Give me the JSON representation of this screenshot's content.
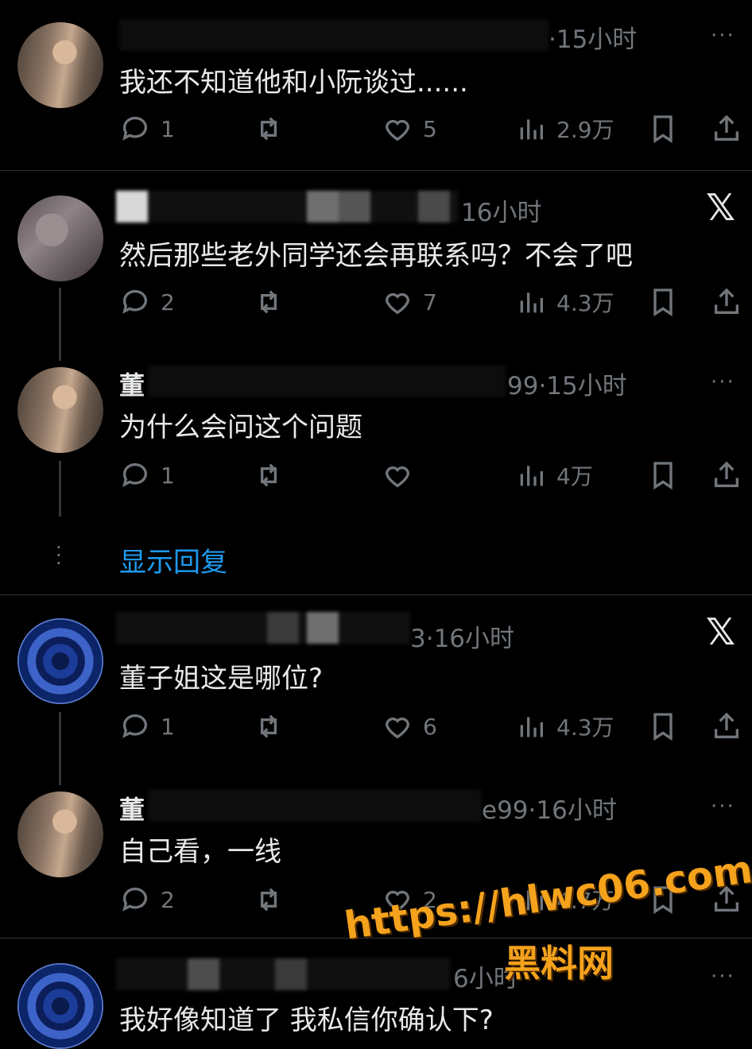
{
  "posts": [
    {
      "meta": "·15小时",
      "name_char": "",
      "text": "我还不知道他和小阮谈过......",
      "replies": "1",
      "likes": "5",
      "views": "2.9万",
      "more": "···",
      "x": false
    },
    {
      "meta": "16小时",
      "name_char": "",
      "text": "然后那些老外同学还会再联系吗？不会了吧",
      "replies": "2",
      "likes": "7",
      "views": "4.3万",
      "more": "",
      "x": true
    },
    {
      "meta": "99·15小时",
      "name_char": "董",
      "text": "为什么会问这个问题",
      "replies": "1",
      "likes": "",
      "views": "4万",
      "more": "···",
      "x": false
    },
    {
      "meta": "3·16小时",
      "name_char": "",
      "text": "董子姐这是哪位?",
      "replies": "1",
      "likes": "6",
      "views": "4.3万",
      "more": "",
      "x": true
    },
    {
      "meta": "e99·16小时",
      "name_char": "董",
      "text": "自己看，一线",
      "replies": "2",
      "likes": "2",
      "views": "4.7万",
      "more": "···",
      "x": false
    },
    {
      "meta": "6小时",
      "name_char": "",
      "text": "我好像知道了   我私信你确认下?",
      "replies": "",
      "likes": "",
      "views": "",
      "more": "···",
      "x": false
    }
  ],
  "show_replies": "显示回复",
  "x_logo": "𝕏",
  "watermark": {
    "url": "https://hlwc06.com",
    "name": "黑料网"
  }
}
